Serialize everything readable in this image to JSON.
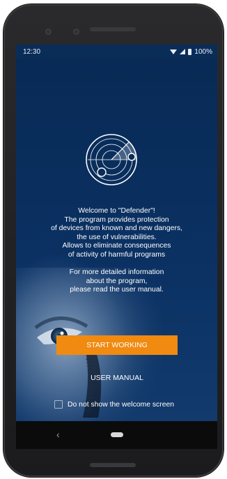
{
  "status_bar": {
    "time": "12:30",
    "battery": "100%",
    "icons": [
      "wifi-icon",
      "signal-icon",
      "battery-icon"
    ]
  },
  "logo": {
    "icon": "radar-icon"
  },
  "welcome_lines": [
    "Welcome to \"Defender\"!",
    "The program provides protection",
    "of devices from known and new dangers,",
    "the use of vulnerabilities.",
    "Allows to eliminate consequences",
    "of activity of harmful programs"
  ],
  "info_lines": [
    "For more detailed information",
    "about the program,",
    "please read the user manual."
  ],
  "buttons": {
    "start": "START WORKING",
    "manual": "USER MANUAL"
  },
  "checkbox": {
    "label": "Do not show the welcome screen",
    "checked": false
  },
  "nav": {
    "back_icon": "back-icon",
    "home_icon": "home-icon"
  },
  "colors": {
    "background": "#0a2d58",
    "accent": "#f08a10",
    "text": "#ffffff"
  }
}
